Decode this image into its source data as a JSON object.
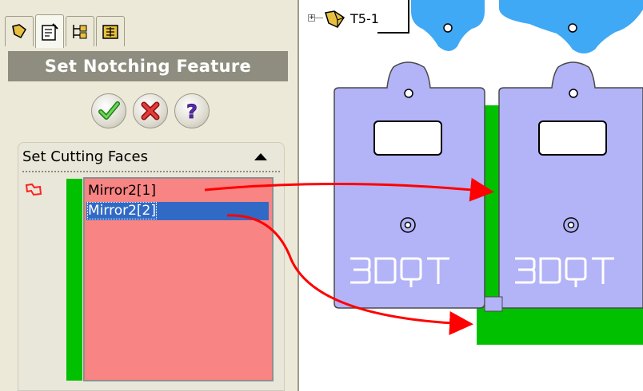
{
  "panel": {
    "tabs": [
      {
        "icon": "feature-manager-icon",
        "active": false
      },
      {
        "icon": "property-manager-icon",
        "active": true
      },
      {
        "icon": "configuration-manager-icon",
        "active": false
      },
      {
        "icon": "dimxpert-icon",
        "active": false
      }
    ],
    "title": "Set Notching Feature",
    "buttons": {
      "ok": "ok-checkmark-icon",
      "cancel": "cancel-x-icon",
      "help": "help-question-icon"
    },
    "group": {
      "title": "Set Cutting Faces",
      "faces": [
        {
          "label": "Mirror2[1]",
          "selected": false
        },
        {
          "label": "Mirror2[2]",
          "selected": true
        }
      ]
    }
  },
  "graphics": {
    "tree_node": {
      "label": "T5-1",
      "icon": "part-icon",
      "expander": "+"
    },
    "parts": [
      {
        "logo": "3DQT"
      },
      {
        "logo": "3DQT"
      }
    ],
    "colors": {
      "plate": "#b3b3f7",
      "tab_top": "#3fa9f5",
      "highlight_face": "#00c000",
      "arrow": "#ff0000",
      "selection": "#316ac5",
      "list_bg": "#f98484"
    }
  }
}
